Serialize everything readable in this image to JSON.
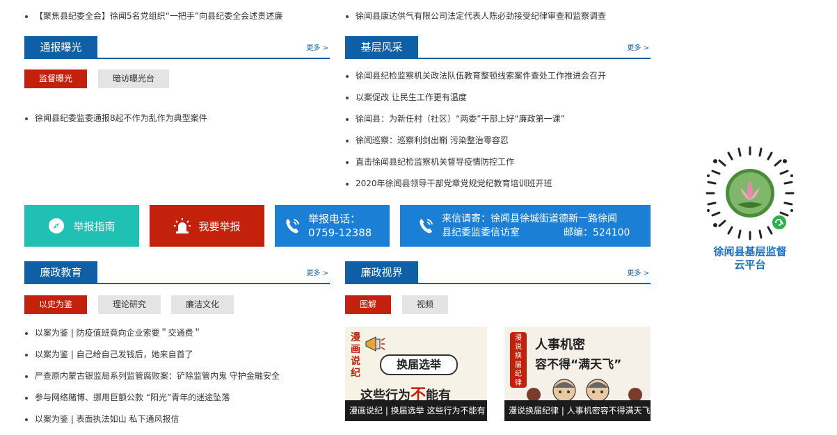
{
  "top_news": {
    "left": "【聚焦县纪委全会】徐闻5名党组织“一把手”向县纪委全会述责述廉",
    "right": "徐闻县康达供气有限公司法定代表人陈必劲接受纪律审查和监察调查"
  },
  "tongbao": {
    "title": "通报曝光",
    "more": "更多 >",
    "tabs": [
      "监督曝光",
      "暗访曝光台"
    ],
    "items": [
      "徐闻县纪委监委通报8起不作为乱作为典型案件"
    ]
  },
  "jiceng": {
    "title": "基层风采",
    "more": "更多 >",
    "items": [
      "徐闻县纪检监察机关政法队伍教育整顿线索案件查处工作推进会召开",
      "以案促改 让民生工作更有温度",
      "徐闻县：为新任村（社区）“两委”干部上好“廉政第一课”",
      "徐闻巡察：巡察利剑出鞘 污染整治零容忍",
      "直击徐闻县纪检监察机关督导疫情防控工作",
      "2020年徐闻县领导干部党章党规党纪教育培训班开班"
    ]
  },
  "buttons": {
    "guide": "举报指南",
    "report": "我要举报",
    "phone_label": "举报电话：",
    "phone_number": "0759-12388",
    "letter_line1": "来信请寄：徐闻县徐城街道德新一路徐闻",
    "letter_line2": "县纪委监委信访室",
    "postcode": "邮编：524100"
  },
  "lianzheng_edu": {
    "title": "廉政教育",
    "more": "更多 >",
    "tabs": [
      "以史为鉴",
      "理论研究",
      "廉洁文化"
    ],
    "items": [
      "以案为鉴 | 防疫值班竟向企业索要＂交通费＂",
      "以案为鉴 | 自己给自己发钱后，她来自首了",
      "严查原内蒙古银监局系列监管腐败案：铲除监管内鬼 守护金融安全",
      "参与网络赌博、挪用巨额公款 “阳光”青年的迷途坠落",
      "以案为鉴 | 表面执法如山 私下通风报信"
    ]
  },
  "lianzheng_view": {
    "title": "廉政视界",
    "more": "更多 >",
    "tabs": [
      "图解",
      "视频"
    ],
    "pic1": {
      "caption": "漫画说纪 | 换届选举 这些行为不能有",
      "side": [
        "漫",
        "画",
        "说",
        "纪"
      ],
      "headline": "换届选举",
      "bottom_a": "这些行为",
      "bottom_b": "不",
      "bottom_c": "能有"
    },
    "pic2": {
      "caption": "漫说换届纪律 | 人事机密容不得满天飞",
      "seal": [
        "漫",
        "说",
        "换",
        "届",
        "纪",
        "律"
      ],
      "line1": "人事机密",
      "line2": "容不得“满天飞”"
    }
  },
  "qrcode": {
    "label_line1": "徐闻县基层监督",
    "label_line2": "云平台"
  },
  "colors": {
    "brand_blue": "#0f5fa6",
    "accent_red": "#c4210c",
    "teal": "#20c0b5",
    "button_blue": "#1b7fd6"
  }
}
